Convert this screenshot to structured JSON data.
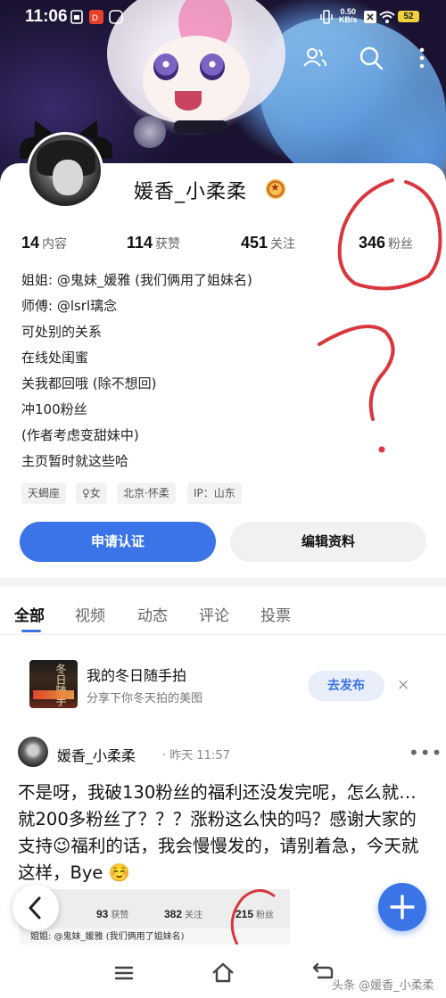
{
  "status_bar": {
    "time": "11:06",
    "net_speed_value": "0.50",
    "net_speed_unit": "KB/s",
    "battery": "52"
  },
  "header_actions": [
    "friends-icon",
    "search-icon",
    "more-vertical-icon"
  ],
  "profile": {
    "username": "媛香_小柔柔",
    "stats": [
      {
        "num": "14",
        "label": "内容"
      },
      {
        "num": "114",
        "label": "获赞"
      },
      {
        "num": "451",
        "label": "关注"
      },
      {
        "num": "346",
        "label": "粉丝"
      }
    ],
    "bio": [
      "姐姐: @鬼妹_媛雅 (我们俩用了姐妹名)",
      "师傅: @lsrl璃念",
      "可处别的关系",
      "在线处闺蜜",
      "关我都回哦 (除不想回)",
      "冲100粉丝",
      "(作者考虑变甜妹中)",
      "主页暂时就这些哈"
    ],
    "tags": [
      "天蝎座",
      "♀女",
      "北京·怀柔",
      "IP：山东"
    ],
    "primary_button": "申请认证",
    "secondary_button": "编辑资料"
  },
  "tabs": [
    "全部",
    "视频",
    "动态",
    "评论",
    "投票"
  ],
  "active_tab": "全部",
  "prompt_card": {
    "title": "我的冬日随手拍",
    "subtitle": "分享下你冬天拍的美图",
    "thumb_text": "冬日随手",
    "publish_button": "去发布",
    "close": "×"
  },
  "post": {
    "author": "媛香_小柔柔",
    "time": "· 昨天 11:57",
    "more": "•••",
    "text": "不是呀，我破130粉丝的福利还没发完呢，怎么就…就200多粉丝了？？？涨粉这么快的吗？感谢大家的支持😉福利的话，我会慢慢发的，请别着急，今天就这样，Bye ☺️",
    "preview": {
      "stats": [
        {
          "num": "93",
          "label": "获赞"
        },
        {
          "num": "382",
          "label": "关注"
        },
        {
          "num": "215",
          "label": "粉丝"
        }
      ],
      "bio_line": "姐姐: @鬼妹_媛雅 (我们俩用了姐妹名)"
    }
  },
  "watermark": "头条 @媛香_小柔柔",
  "colors": {
    "accent": "#3b74e6",
    "annotation": "#d9363e"
  }
}
